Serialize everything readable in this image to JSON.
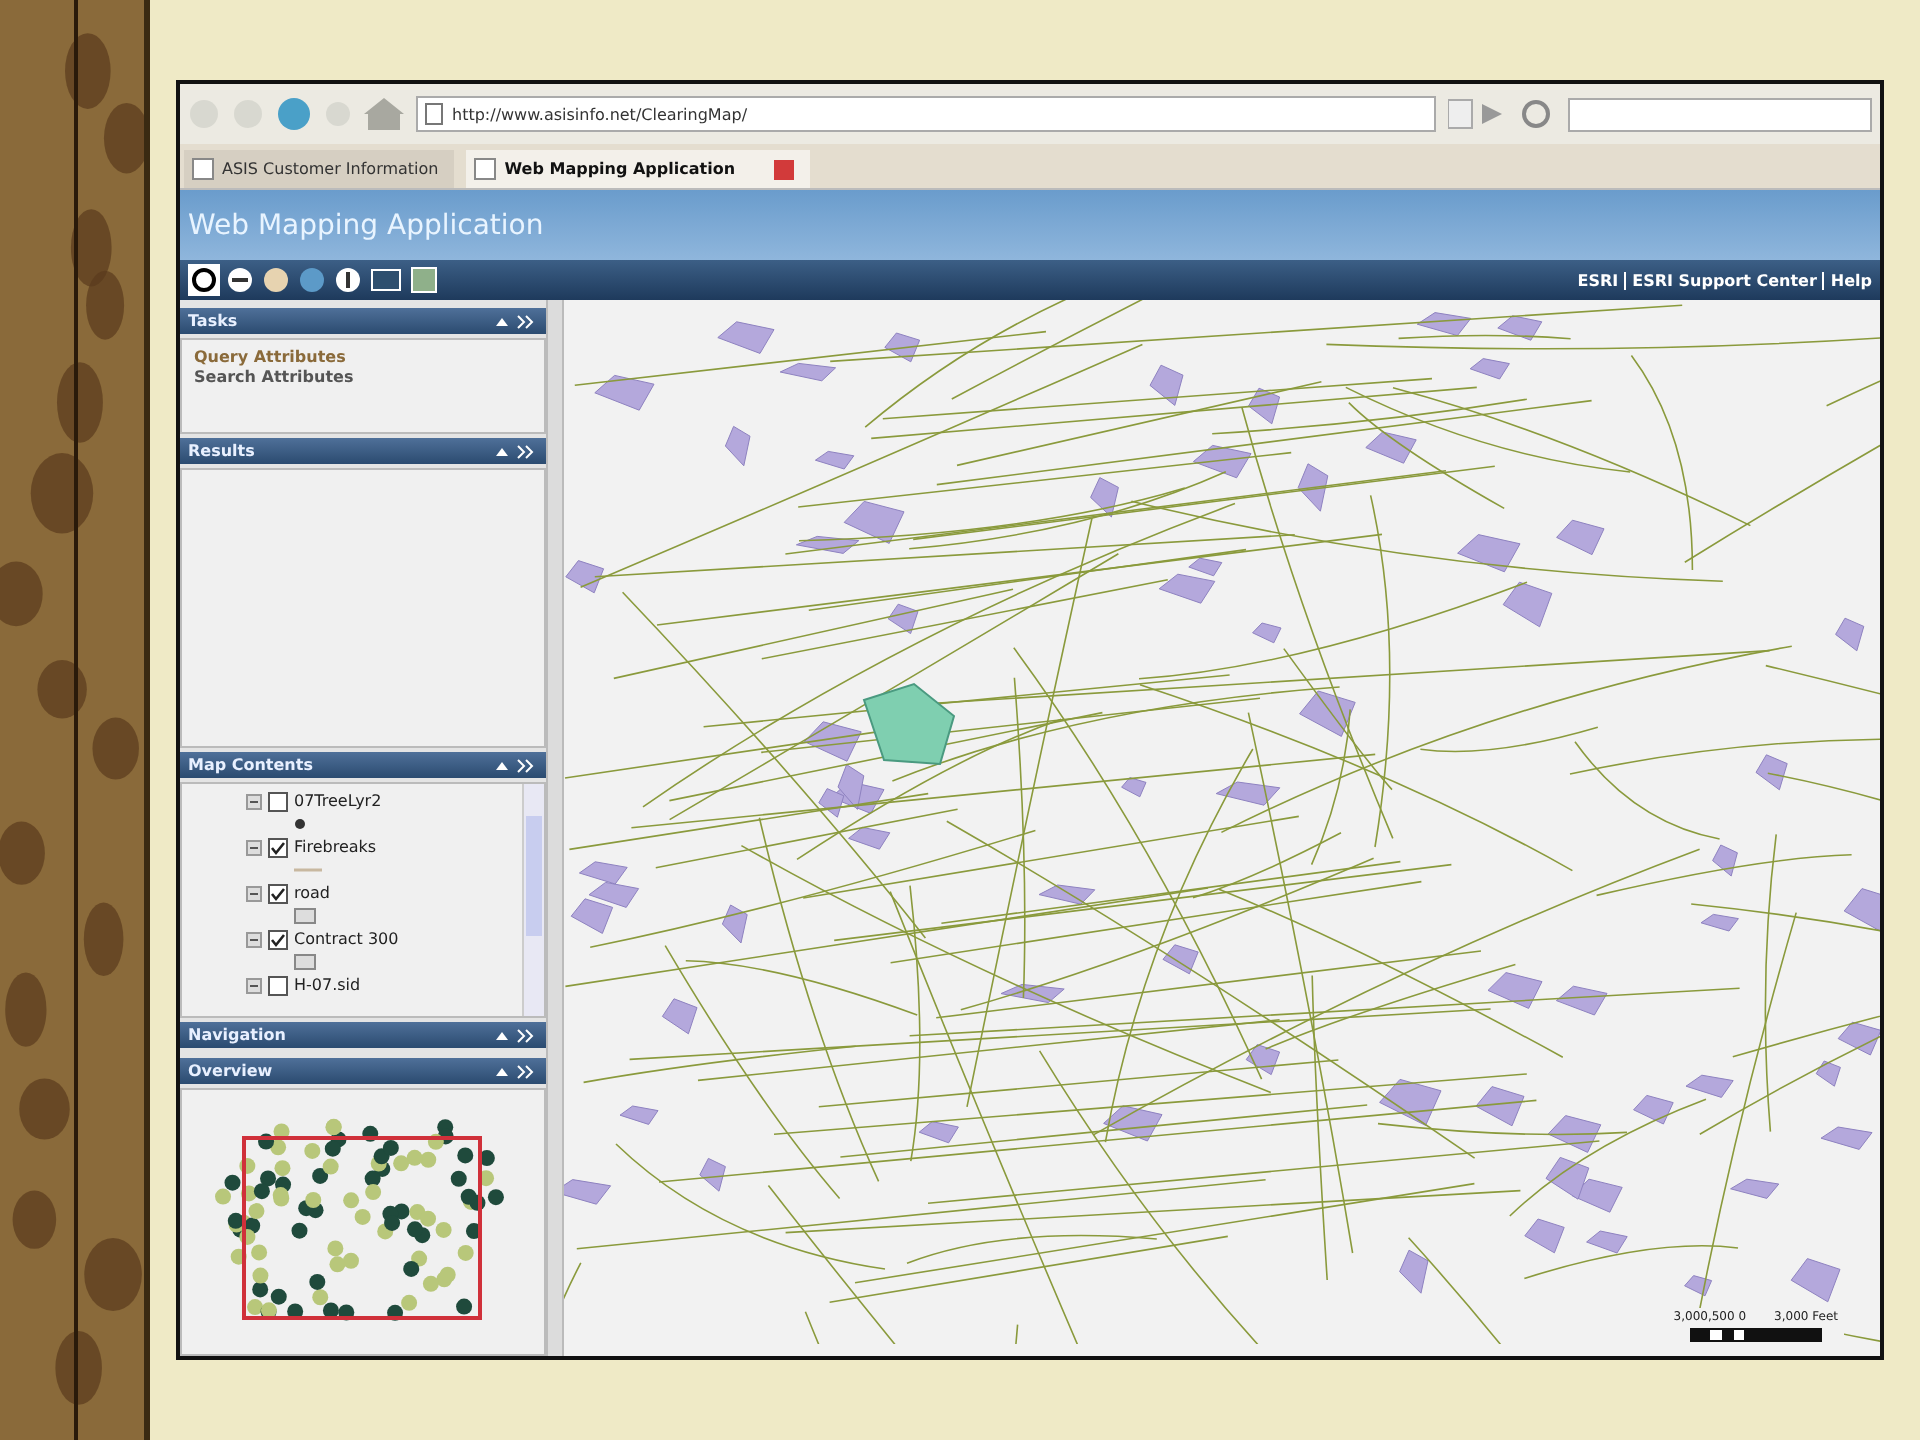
{
  "browser": {
    "url": "http://www.asisinfo.net/ClearingMap/"
  },
  "tabs": [
    {
      "label": "ASIS Customer Information",
      "selected": false
    },
    {
      "label": "Web Mapping Application",
      "selected": true
    }
  ],
  "app": {
    "title": "Web Mapping Application"
  },
  "links": [
    "ESRI",
    "ESRI Support Center",
    "Help"
  ],
  "panels": {
    "tasks": {
      "title": "Tasks",
      "items": [
        {
          "label": "Query Attributes",
          "selected": true
        },
        {
          "label": "Search Attributes",
          "selected": false
        }
      ]
    },
    "results": {
      "title": "Results"
    },
    "map_contents": {
      "title": "Map Contents",
      "layers": [
        {
          "name": "07TreeLyr2",
          "checked": false,
          "legend": {
            "kind": "point"
          }
        },
        {
          "name": "Firebreaks",
          "checked": true,
          "legend": {
            "kind": "line"
          }
        },
        {
          "name": "road",
          "checked": true,
          "legend": {
            "kind": "fill"
          }
        },
        {
          "name": "Contract 300",
          "checked": true,
          "legend": {
            "kind": "fill"
          }
        },
        {
          "name": "H-07.sid",
          "checked": false
        }
      ]
    },
    "navigation": {
      "title": "Navigation"
    },
    "overview": {
      "title": "Overview"
    }
  },
  "scale_bar": {
    "left_label": "3,000,500 0",
    "right_label": "3,000 Feet"
  }
}
